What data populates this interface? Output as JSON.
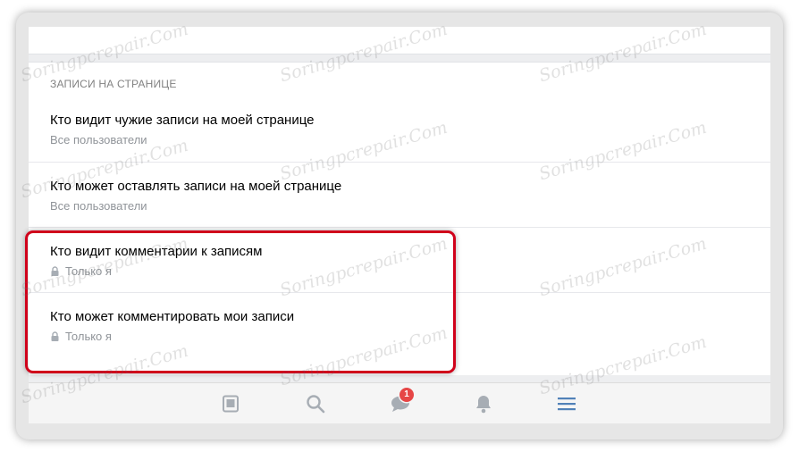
{
  "watermark": "Soringpcrepair.Com",
  "section": {
    "header": "ЗАПИСИ НА СТРАНИЦЕ"
  },
  "items": [
    {
      "title": "Кто видит чужие записи на моей странице",
      "value": "Все пользователи",
      "locked": false
    },
    {
      "title": "Кто может оставлять записи на моей странице",
      "value": "Все пользователи",
      "locked": false
    },
    {
      "title": "Кто видит комментарии к записям",
      "value": "Только я",
      "locked": true
    },
    {
      "title": "Кто может комментировать мои записи",
      "value": "Только я",
      "locked": true
    }
  ],
  "bottom_nav": {
    "items": [
      {
        "icon": "news-icon",
        "label": ""
      },
      {
        "icon": "search-icon",
        "label": ""
      },
      {
        "icon": "messages-icon",
        "badge": "1"
      },
      {
        "icon": "notifications-icon",
        "label": ""
      },
      {
        "icon": "menu-icon",
        "label": ""
      }
    ],
    "active_color": "#5181b8",
    "inactive_color": "#a7adb4",
    "badge_color": "#e64646"
  },
  "highlight_color": "#d0021b"
}
